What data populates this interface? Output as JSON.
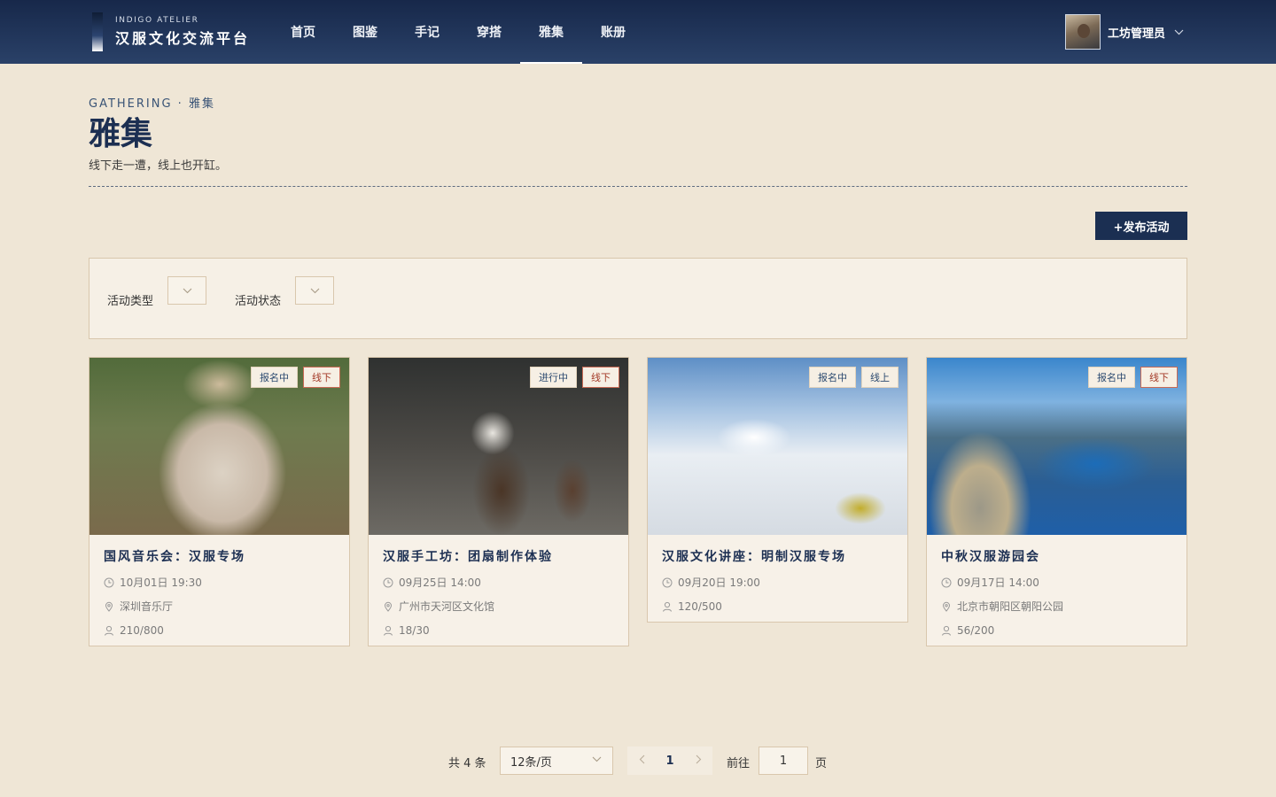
{
  "header": {
    "brand_en": "INDIGO ATELIER",
    "brand_cn": "汉服文化交流平台",
    "nav": [
      {
        "label": "首页",
        "active": false
      },
      {
        "label": "图鉴",
        "active": false
      },
      {
        "label": "手记",
        "active": false
      },
      {
        "label": "穿搭",
        "active": false
      },
      {
        "label": "雅集",
        "active": true
      },
      {
        "label": "账册",
        "active": false
      }
    ],
    "user_name": "工坊管理员"
  },
  "page": {
    "eyebrow": "GATHERING · 雅集",
    "title": "雅集",
    "subtitle": "线下走一遭，线上也开缸。",
    "publish_button": "+发布活动"
  },
  "filters": {
    "type_label": "活动类型",
    "status_label": "活动状态"
  },
  "events": [
    {
      "title": "国风音乐会：汉服专场",
      "status": "报名中",
      "mode": "线下",
      "time": "10月01日 19:30",
      "location": "深圳音乐厅",
      "attendance": "210/800"
    },
    {
      "title": "汉服手工坊：团扇制作体验",
      "status": "进行中",
      "mode": "线下",
      "time": "09月25日 14:00",
      "location": "广州市天河区文化馆",
      "attendance": "18/30"
    },
    {
      "title": "汉服文化讲座：明制汉服专场",
      "status": "报名中",
      "mode": "线上",
      "time": "09月20日 19:00",
      "location": "",
      "attendance": "120/500"
    },
    {
      "title": "中秋汉服游园会",
      "status": "报名中",
      "mode": "线下",
      "time": "09月17日 14:00",
      "location": "北京市朝阳区朝阳公园",
      "attendance": "56/200"
    }
  ],
  "pagination": {
    "total_text": "共 4 条",
    "page_size": "12条/页",
    "current_page": "1",
    "goto_label": "前往",
    "goto_value": "1",
    "goto_suffix": "页"
  },
  "colors": {
    "header_bg": "#17284a",
    "page_bg": "#efe6d6",
    "accent": "#1b2f52",
    "offline_tag": "#a43a28"
  }
}
